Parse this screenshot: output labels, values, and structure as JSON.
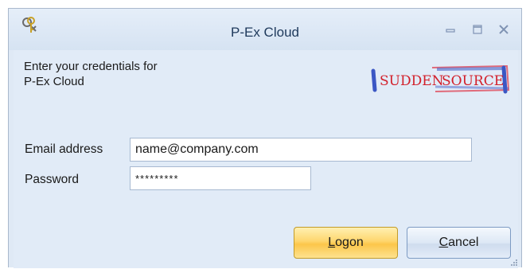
{
  "window": {
    "title": "P-Ex Cloud",
    "app_icon": "keys-icon",
    "controls": [
      "minimize-icon",
      "maximize-icon",
      "close-icon"
    ]
  },
  "intro": {
    "text": "Enter your credentials for\nP-Ex Cloud"
  },
  "logo": {
    "left_text": "SUDDEN",
    "right_text": "SOURCE",
    "colors": {
      "text": "#d21f2a",
      "brush_blue": "#3b57c4",
      "brush_red": "#e04a5a"
    }
  },
  "form": {
    "email_label": "Email address",
    "email_value": "name@company.com",
    "password_label": "Password",
    "password_value": "*********"
  },
  "buttons": {
    "logon_first": "L",
    "logon_rest": "ogon",
    "cancel_first": "C",
    "cancel_rest": "ancel"
  },
  "colors": {
    "titlebar": "#dbe6f4",
    "body": "#e1ebf7",
    "primary_button": "#fcc64a",
    "secondary_button": "#dde8f5"
  }
}
